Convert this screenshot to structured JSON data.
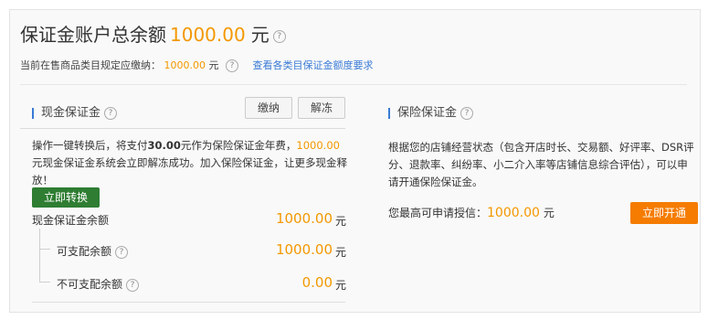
{
  "header": {
    "title": "保证金账户总余额",
    "amount": "1000.00",
    "unit": "元",
    "help_icon": "question-circle-icon"
  },
  "sub": {
    "label": "当前在售商品类目规定应缴纳：",
    "value": "1000.00",
    "unit": "元",
    "link": "查看各类目保证金额度要求"
  },
  "cash": {
    "title": "现金保证金",
    "btn_pay": "缴纳",
    "btn_unfreeze": "解冻",
    "desc_1": "操作一键转换后，将支付",
    "desc_bold": "30.00",
    "desc_2": "元作为保险保证金年费，",
    "desc_orange": "1000.00",
    "desc_3": "元现金保证金系统会立即解冻成功。加入保险保证金，让更多现金释放！",
    "btn_convert": "立即转换",
    "balance_label": "现金保证金余额",
    "balance_value": "1000.00",
    "balance_unit": "元",
    "available_label": "可支配余额",
    "available_value": "1000.00",
    "available_unit": "元",
    "unavailable_label": "不可支配余额",
    "unavailable_value": "0.00",
    "unavailable_unit": "元"
  },
  "insurance": {
    "title": "保险保证金",
    "desc": "根据您的店铺经营状态（包含开店时长、交易额、好评率、DSR评分、退款率、纠纷率、小二介入率等店铺信息综合评估），可以申请开通保险保证金。",
    "credit_label": "您最高可申请授信：",
    "credit_value": "1000.00",
    "credit_unit": "元",
    "btn_open": "立即开通"
  },
  "colors": {
    "accent_orange": "#f39800",
    "link_blue": "#3a7bd5",
    "button_green": "#2e7d32",
    "button_orange": "#f57c00"
  }
}
